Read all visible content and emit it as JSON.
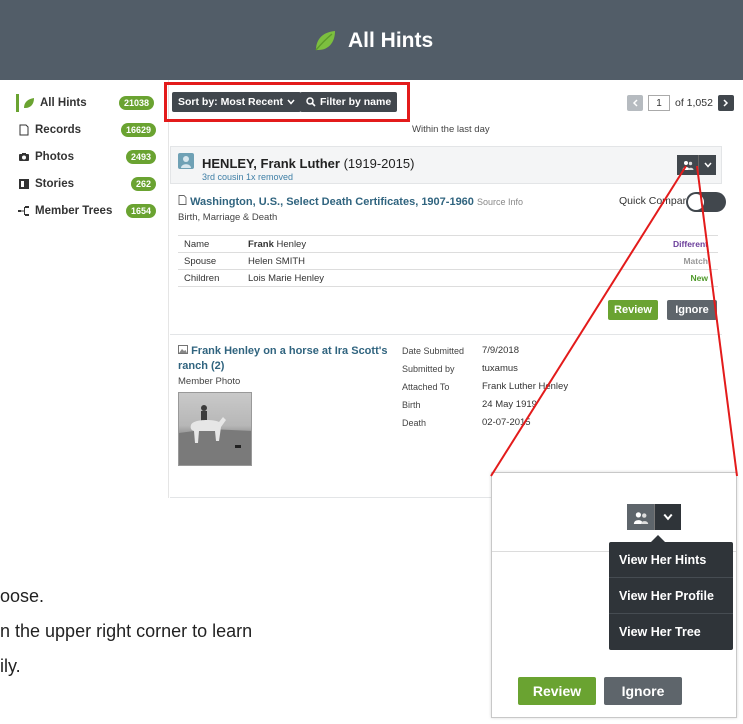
{
  "header": {
    "title": "All Hints",
    "leaf_icon": "leaf-icon",
    "bg_color": "#525d68",
    "leaf_color": "#7cbf3f"
  },
  "sidebar": {
    "items": [
      {
        "label": "All Hints",
        "count": "21038",
        "icon": "leaf-icon",
        "active": true
      },
      {
        "label": "Records",
        "count": "16629",
        "icon": "document-icon"
      },
      {
        "label": "Photos",
        "count": "2493",
        "icon": "camera-icon"
      },
      {
        "label": "Stories",
        "count": "262",
        "icon": "story-icon"
      },
      {
        "label": "Member Trees",
        "count": "1654",
        "icon": "tree-icon"
      }
    ],
    "badge_color": "#6aa331"
  },
  "toolbar": {
    "sort_label": "Sort by: Most Recent",
    "filter_label": "Filter by name",
    "highlight_color": "#e31b1b"
  },
  "pager": {
    "page": "1",
    "of_label": "of 1,052"
  },
  "filter_note": "Within the last day",
  "person": {
    "name": "HENLEY, Frank Luther",
    "years": "(1919-2015)",
    "relationship": "3rd cousin 1x removed"
  },
  "record_hint": {
    "title": "Washington, U.S., Select Death Certificates, 1907-1960",
    "source_info": "Source Info",
    "category": "Birth, Marriage & Death",
    "quick_compare": "Quick Compare",
    "rows": [
      {
        "field": "Name",
        "value_bold": "Frank",
        "value_rest": " Henley",
        "status": "Different",
        "status_color": "#6a3d9a"
      },
      {
        "field": "Spouse",
        "value_bold": "",
        "value_rest": "Helen SMITH",
        "status": "Match",
        "status_color": "#999999"
      },
      {
        "field": "Children",
        "value_bold": "",
        "value_rest": "Lois Marie Henley",
        "status": "New",
        "status_color": "#4f9a2a"
      }
    ],
    "review_label": "Review",
    "ignore_label": "Ignore"
  },
  "photo_hint": {
    "title": "Frank Henley on a horse at Ira Scott's ranch (2)",
    "category": "Member Photo",
    "meta": [
      {
        "label": "Date Submitted",
        "value": "7/9/2018"
      },
      {
        "label": "Submitted by",
        "value": "tuxamus"
      },
      {
        "label": "Attached To",
        "value": "Frank Luther Henley"
      },
      {
        "label": "Birth",
        "value": "24 May 1919"
      },
      {
        "label": "Death",
        "value": "02-07-2015"
      }
    ]
  },
  "instructions": {
    "line1": "oose.",
    "line2": "n the upper right corner to learn",
    "line3": "ily."
  },
  "callout": {
    "menu": [
      "View Her Hints",
      "View Her Profile",
      "View Her Tree"
    ],
    "review_label": "Review",
    "ignore_label": "Ignore"
  }
}
